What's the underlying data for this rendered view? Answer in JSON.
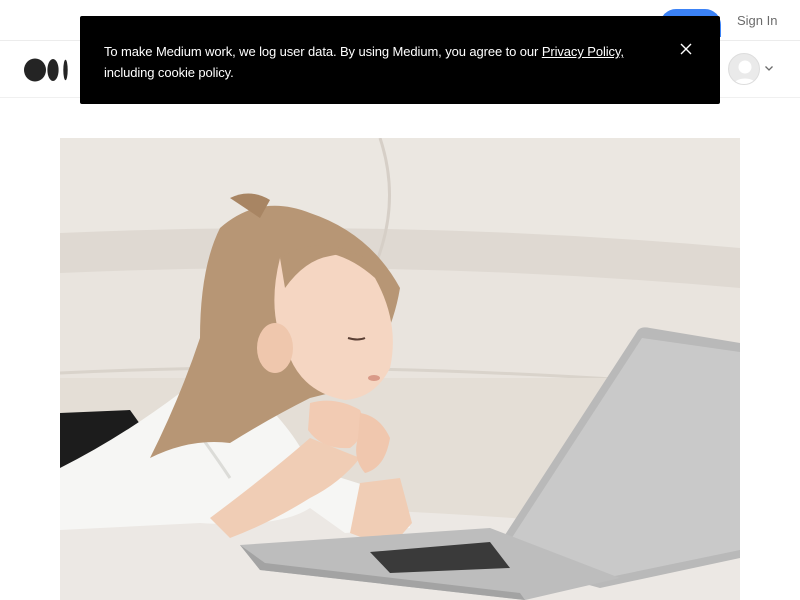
{
  "header": {
    "sign_in_label": "Sign In",
    "logo_alt": "Medium"
  },
  "cookie_banner": {
    "text_before_link": "To make Medium work, we log user data. By using Medium, you agree to our ",
    "link_text": "Privacy Policy,",
    "text_after_link": " including cookie policy."
  },
  "colors": {
    "banner_bg": "#000000",
    "accent": "#3b82f6"
  },
  "hero": {
    "icon": "photo-girl-with-laptop"
  }
}
